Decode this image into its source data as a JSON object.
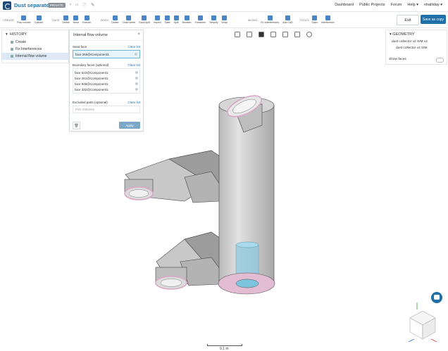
{
  "app": {
    "title": "Dust separator",
    "privacy_badge": "PRIVATE",
    "nav": [
      "Dashboard",
      "Public Projects",
      "Forum",
      "Help ▾",
      "nhalliday ▾"
    ]
  },
  "toolbar": {
    "groups": [
      {
        "label": "CREATE",
        "tools": [
          "Flow volume",
          "Cylinder"
        ]
      },
      {
        "label": "FACE",
        "tools": [
          "Delete",
          "Move",
          "Extrude"
        ]
      },
      {
        "label": "BODY",
        "tools": [
          "Delete",
          "Close sheet",
          "Facet split",
          "Imprint",
          "Slate",
          "Split",
          "Boolean",
          "Transform",
          "Simplify",
          "Wrap"
        ]
      },
      {
        "label": "MODEL",
        "tools": [
          "Fix interferences",
          "Add CAD"
        ]
      },
      {
        "label": "TOOLS",
        "tools": [
          "Gaps",
          "Interference"
        ]
      }
    ],
    "exit_label": "Exit",
    "save_label": "Save as copy"
  },
  "history": {
    "title": "HISTORY",
    "items": [
      {
        "label": "Create",
        "active": false
      },
      {
        "label": "Fix Interferences",
        "active": false
      },
      {
        "label": "Internal flow volume",
        "active": true
      }
    ]
  },
  "dialog": {
    "title": "Internal flow volume",
    "seed": {
      "label": "Seed face",
      "clear": "Clear list",
      "value": "face 266@Component1"
    },
    "boundary": {
      "label": "Boundary faces (optional)",
      "clear": "Clear list",
      "faces": [
        "face 522@Component1",
        "face 261@Component1",
        "face 948@Component1",
        "face 332@Component1"
      ]
    },
    "excluded": {
      "label": "Excluded parts (optional)",
      "clear": "Clear list",
      "placeholder": "Pick Volumes"
    },
    "apply_label": "Apply"
  },
  "geometry": {
    "title": "GEOMETRY",
    "items": [
      "dust collector v2 SIM v2",
      "dust collector v2 SIM"
    ],
    "show_faces_label": "Show faces"
  },
  "viewport": {
    "scale_label": "0.1 m"
  },
  "colors": {
    "brand": "#1f6fa8",
    "highlight_pink": "#e8b8d0",
    "highlight_cyan": "#7cc6e0",
    "body_gray": "#cfcfcf"
  }
}
